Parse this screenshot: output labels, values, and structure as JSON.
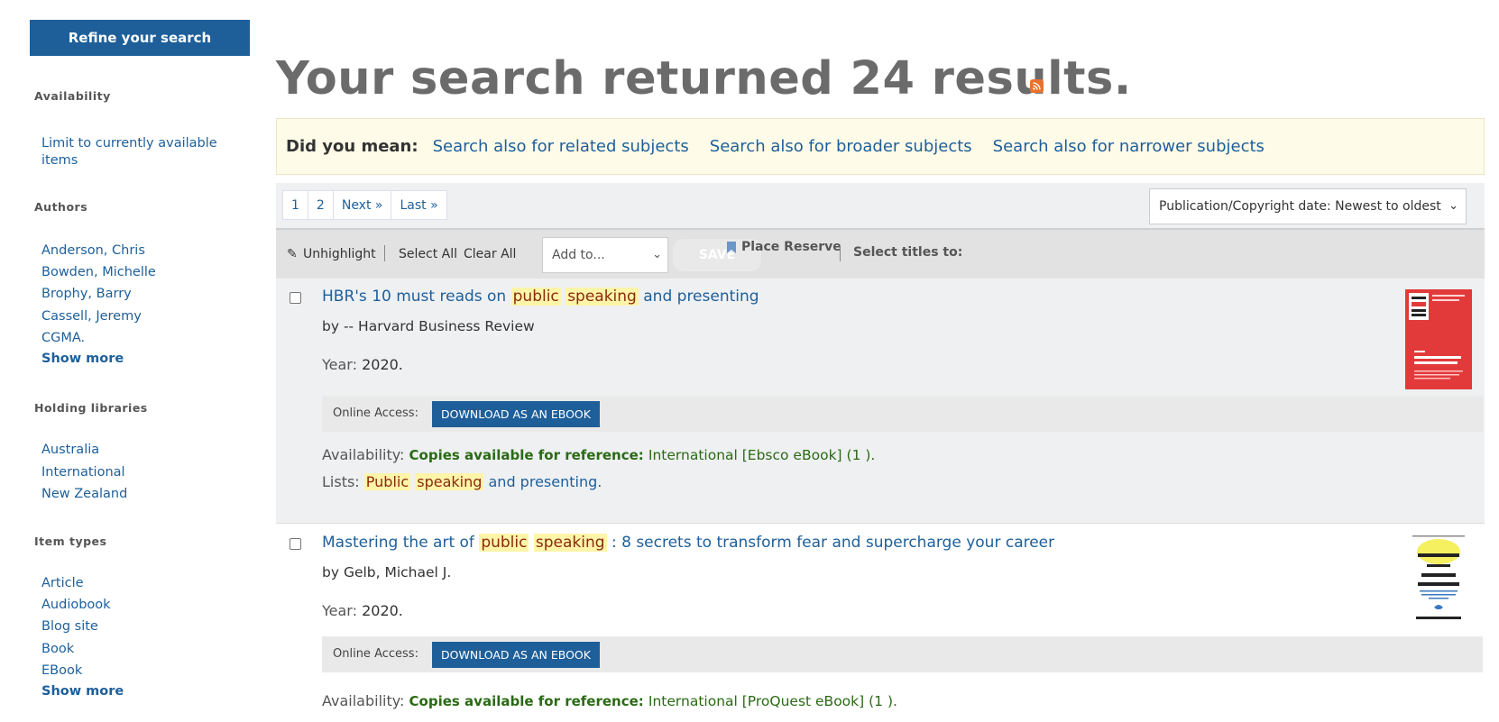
{
  "sidebar": {
    "refine_label": "Refine your search",
    "facets": [
      {
        "heading": "Availability",
        "items": [
          "Limit to currently available items"
        ]
      },
      {
        "heading": "Authors",
        "items": [
          "Anderson, Chris",
          "Bowden, Michelle",
          "Brophy, Barry",
          "Cassell, Jeremy",
          "CGMA."
        ],
        "show_more": "Show more"
      },
      {
        "heading": "Holding libraries",
        "items": [
          "Australia",
          "International",
          "New Zealand"
        ]
      },
      {
        "heading": "Item types",
        "items": [
          "Article",
          "Audiobook",
          "Blog site",
          "Book",
          "EBook"
        ],
        "show_more": "Show more"
      }
    ]
  },
  "main": {
    "title": "Your search returned 24 results.",
    "did_you_mean": {
      "label": "Did you mean:",
      "links": [
        "Search also for related subjects",
        "Search also for broader subjects",
        "Search also for narrower subjects"
      ]
    },
    "pagination": [
      "1",
      "2",
      "Next »",
      "Last »"
    ],
    "sort_selected": "Publication/Copyright date: Newest to oldest",
    "toolbar": {
      "unhighlight": "Unhighlight",
      "select_all": "Select All",
      "clear_all": "Clear All",
      "add_to_placeholder": "Add to...",
      "save": "SAVE",
      "place_reserve": "Place Reserve",
      "select_titles": "Select titles to:"
    },
    "results": [
      {
        "title_pre": "HBR's 10 must reads on ",
        "title_hl1": "public",
        "title_hl2": "speaking",
        "title_post": " and presenting",
        "author": "by -- Harvard Business Review",
        "year_label": "Year:",
        "year": "2020.",
        "online_label": "Online Access:",
        "download_label": "DOWNLOAD AS AN EBOOK",
        "availability_label": "Availability:",
        "availability_strong": "Copies available for reference:",
        "availability_detail": "International [Ebsco eBook] (1 ).",
        "lists_label": "Lists:",
        "lists_hl1": "Public",
        "lists_hl2": "speaking",
        "lists_post": " and presenting",
        "lists_end": "."
      },
      {
        "title_pre": "Mastering the art of ",
        "title_hl1": "public",
        "title_hl2": "speaking",
        "title_post": " : 8 secrets to transform fear and supercharge your career",
        "author": "by Gelb, Michael J.",
        "year_label": "Year:",
        "year": "2020.",
        "online_label": "Online Access:",
        "download_label": "DOWNLOAD AS AN EBOOK",
        "availability_label": "Availability:",
        "availability_strong": "Copies available for reference:",
        "availability_detail": "International [ProQuest eBook] (1 )."
      }
    ]
  },
  "icons": {
    "rss": "rss-icon",
    "pencil": "pencil-icon",
    "bookmark": "bookmark-icon",
    "chevron": "chevron-down-icon"
  },
  "colors": {
    "brand_blue": "#1e5f9a",
    "highlight": "#fff5a8",
    "available_green": "#2a6a14"
  }
}
